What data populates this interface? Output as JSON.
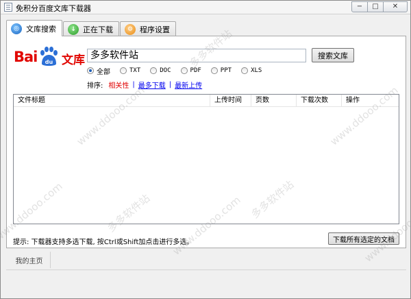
{
  "window": {
    "title": "免积分百度文库下载器",
    "minimize_icon": "minimize-icon",
    "maximize_icon": "maximize-icon",
    "close_icon": "close-icon"
  },
  "tabs": [
    {
      "label": "文库搜索",
      "icon": "search-icon",
      "active": true
    },
    {
      "label": "正在下载",
      "icon": "download-icon",
      "active": false
    },
    {
      "label": "程序设置",
      "icon": "settings-icon",
      "active": false
    }
  ],
  "logo": {
    "bai": "Bai",
    "du": "du",
    "wenku": "文库"
  },
  "search": {
    "value": "多多软件站",
    "button_label": "搜索文库"
  },
  "filters": {
    "options": [
      "全部",
      "TXT",
      "DOC",
      "PDF",
      "PPT",
      "XLS"
    ],
    "selected": "全部"
  },
  "sort": {
    "label": "排序:",
    "options": [
      "相关性",
      "最多下载",
      "最新上传"
    ],
    "separators": [
      "|",
      "|"
    ],
    "active": "相关性"
  },
  "table": {
    "columns": [
      "文件标题",
      "上传时间",
      "页数",
      "下载次数",
      "操作"
    ],
    "rows": []
  },
  "footer": {
    "hint": "提示: 下载器支持多选下载, 按Ctrl或Shift加点击进行多选。",
    "download_button_label": "下载所有选定的文档"
  },
  "home_tab": "我的主页",
  "watermarks": {
    "site_cn": "多多软件站",
    "site_url": "www.ddooo.com"
  },
  "colors": {
    "brand_red": "#e10601",
    "brand_blue": "#2b6fd6",
    "link_blue": "#0000ee",
    "active_red": "#e00000"
  }
}
